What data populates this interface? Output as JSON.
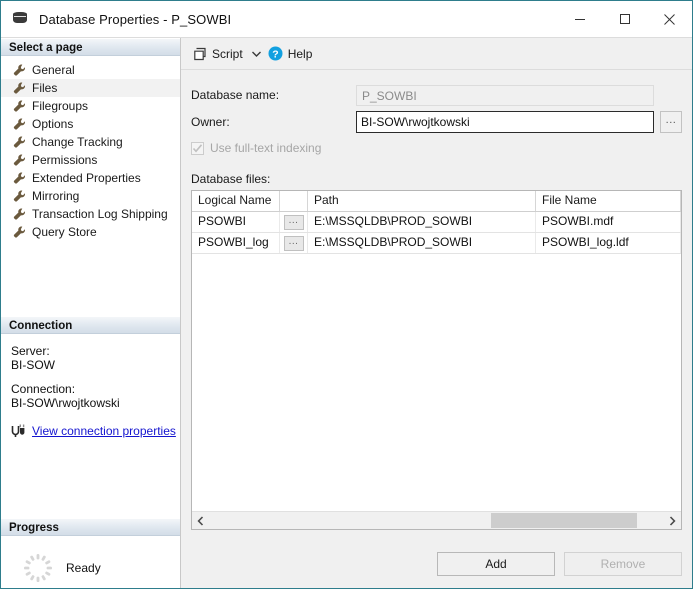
{
  "window": {
    "title": "Database Properties - P_SOWBI",
    "icon": "database-icon",
    "minimize_label": "Minimize",
    "maximize_label": "Maximize",
    "close_label": "Close",
    "accent_color": "#2e7d8c"
  },
  "sidebar": {
    "select_page_header": "Select a page",
    "pages": [
      {
        "label": "General",
        "selected": false
      },
      {
        "label": "Files",
        "selected": true
      },
      {
        "label": "Filegroups",
        "selected": false
      },
      {
        "label": "Options",
        "selected": false
      },
      {
        "label": "Change Tracking",
        "selected": false
      },
      {
        "label": "Permissions",
        "selected": false
      },
      {
        "label": "Extended Properties",
        "selected": false
      },
      {
        "label": "Mirroring",
        "selected": false
      },
      {
        "label": "Transaction Log Shipping",
        "selected": false
      },
      {
        "label": "Query Store",
        "selected": false
      }
    ],
    "connection": {
      "header": "Connection",
      "server_label": "Server:",
      "server_value": "BI-SOW",
      "connection_label": "Connection:",
      "connection_value": "BI-SOW\\rwojtkowski",
      "link_text": "View connection properties",
      "link_color": "#1414cf"
    },
    "progress": {
      "header": "Progress",
      "status": "Ready"
    }
  },
  "toolbar": {
    "script_label": "Script",
    "help_label": "Help",
    "help_color": "#12a0e0"
  },
  "form": {
    "database_name_label": "Database name:",
    "database_name_value": "P_SOWBI",
    "owner_label": "Owner:",
    "owner_value": "BI-SOW\\rwojtkowski",
    "browse_label": "...",
    "fulltext_label": "Use full-text indexing",
    "fulltext_checked": true,
    "fulltext_enabled": false
  },
  "files_grid": {
    "caption": "Database files:",
    "columns": [
      "Logical Name",
      "",
      "Path",
      "File Name"
    ],
    "rows": [
      {
        "logical_name": "PSOWBI",
        "browse": "...",
        "path": "E:\\MSSQLDB\\PROD_SOWBI",
        "file_name": "PSOWBI.mdf"
      },
      {
        "logical_name": "PSOWBI_log",
        "browse": "...",
        "path": "E:\\MSSQLDB\\PROD_SOWBI",
        "file_name": "PSOWBI_log.ldf"
      }
    ],
    "scroll_left_label": "Scroll left",
    "scroll_right_label": "Scroll right"
  },
  "footer": {
    "add_label": "Add",
    "remove_label": "Remove",
    "remove_enabled": false
  }
}
